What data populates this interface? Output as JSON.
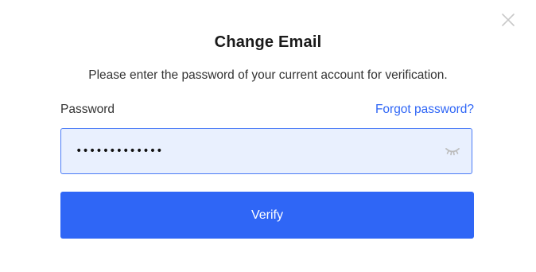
{
  "dialog": {
    "title": "Change Email",
    "subtitle": "Please enter the password of your current account for verification.",
    "close_icon": "close-icon"
  },
  "password_field": {
    "label": "Password",
    "forgot_link": "Forgot password?",
    "value": "•••••••••••••",
    "input_type": "password",
    "toggle_icon": "eye-closed-icon"
  },
  "actions": {
    "verify_label": "Verify"
  },
  "colors": {
    "accent": "#2f66f6",
    "input_background": "#e9f0fe",
    "input_border": "#4a7bf7",
    "text_primary": "#1a1a1a",
    "text_secondary": "#333333",
    "icon_muted": "#c4c4c4"
  }
}
